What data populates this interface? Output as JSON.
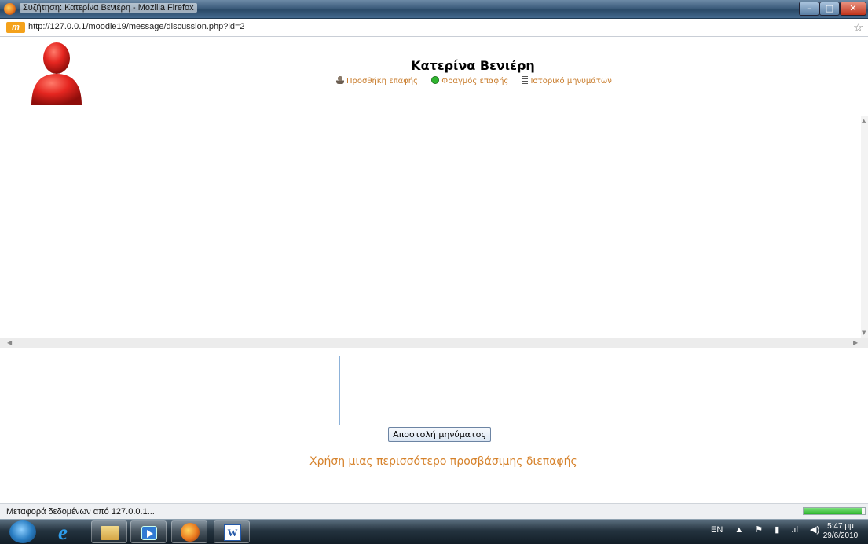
{
  "window": {
    "title": "Συζήτηση: Κατερίνα Βενιέρη - Mozilla Firefox",
    "minimize_glyph": "–",
    "maximize_glyph": "□",
    "close_glyph": "✕"
  },
  "address_bar": {
    "site_icon_text": "m",
    "url": "http://127.0.0.1/moodle19/message/discussion.php?id=2",
    "bookmark_glyph": "☆"
  },
  "contact": {
    "name": "Κατερίνα Βενιέρη",
    "avatar_color": "#e52620"
  },
  "actions": [
    {
      "label": "Προσθήκη επαφής",
      "icon": "add-contact-icon"
    },
    {
      "label": "Φραγμός επαφής",
      "icon": "block-contact-icon"
    },
    {
      "label": "Ιστορικό μηνυμάτων",
      "icon": "history-icon"
    }
  ],
  "message_form": {
    "input_value": "",
    "send_label": "Αποστολή μηνύματος"
  },
  "accessible_link": "Χρήση μιας περισσότερο προσβάσιμης διεπαφής",
  "status_bar": {
    "text": "Μεταφορά δεδομένων από 127.0.0.1...",
    "progress_fraction": 0.95,
    "progress_color": "#2cb52c"
  },
  "taskbar": {
    "apps": [
      "Internet Explorer",
      "Windows Explorer",
      "Windows Media Player",
      "Mozilla Firefox",
      "Microsoft Word"
    ],
    "language": "EN",
    "time": "5:47 μμ",
    "date": "29/6/2010"
  },
  "colors": {
    "link_orange": "#d6822b",
    "action_orange": "#c87b2a"
  }
}
